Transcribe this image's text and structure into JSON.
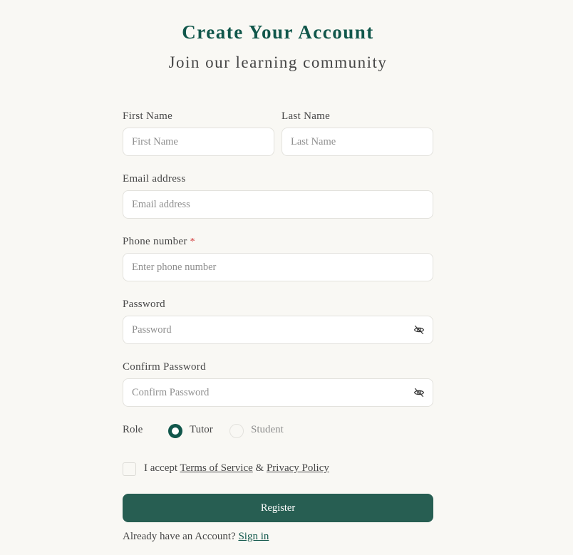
{
  "header": {
    "title": "Create Your Account",
    "subtitle": "Join our learning community"
  },
  "form": {
    "first_name": {
      "label": "First Name",
      "placeholder": "First Name",
      "value": ""
    },
    "last_name": {
      "label": "Last Name",
      "placeholder": "Last Name",
      "value": ""
    },
    "email": {
      "label": "Email address",
      "placeholder": "Email address",
      "value": ""
    },
    "phone": {
      "label": "Phone number",
      "required_mark": "*",
      "placeholder": "Enter phone number",
      "value": ""
    },
    "password": {
      "label": "Password",
      "placeholder": "Password",
      "value": "",
      "toggle_icon": "eye-off-icon"
    },
    "confirm_password": {
      "label": "Confirm Password",
      "placeholder": "Confirm Password",
      "value": "",
      "toggle_icon": "eye-off-icon"
    },
    "role": {
      "label": "Role",
      "options": [
        "Tutor",
        "Student"
      ],
      "selected": "Tutor"
    },
    "terms": {
      "prefix": "I accept",
      "terms_link": "Terms of Service",
      "separator": "&",
      "privacy_link": "Privacy Policy",
      "checked": false
    },
    "register_label": "Register",
    "signin": {
      "prompt": "Already have an Account?",
      "link": "Sign in"
    }
  },
  "colors": {
    "accent": "#11574b",
    "button": "#275e52",
    "background": "#f9f8f4",
    "required": "#d23b3b"
  }
}
